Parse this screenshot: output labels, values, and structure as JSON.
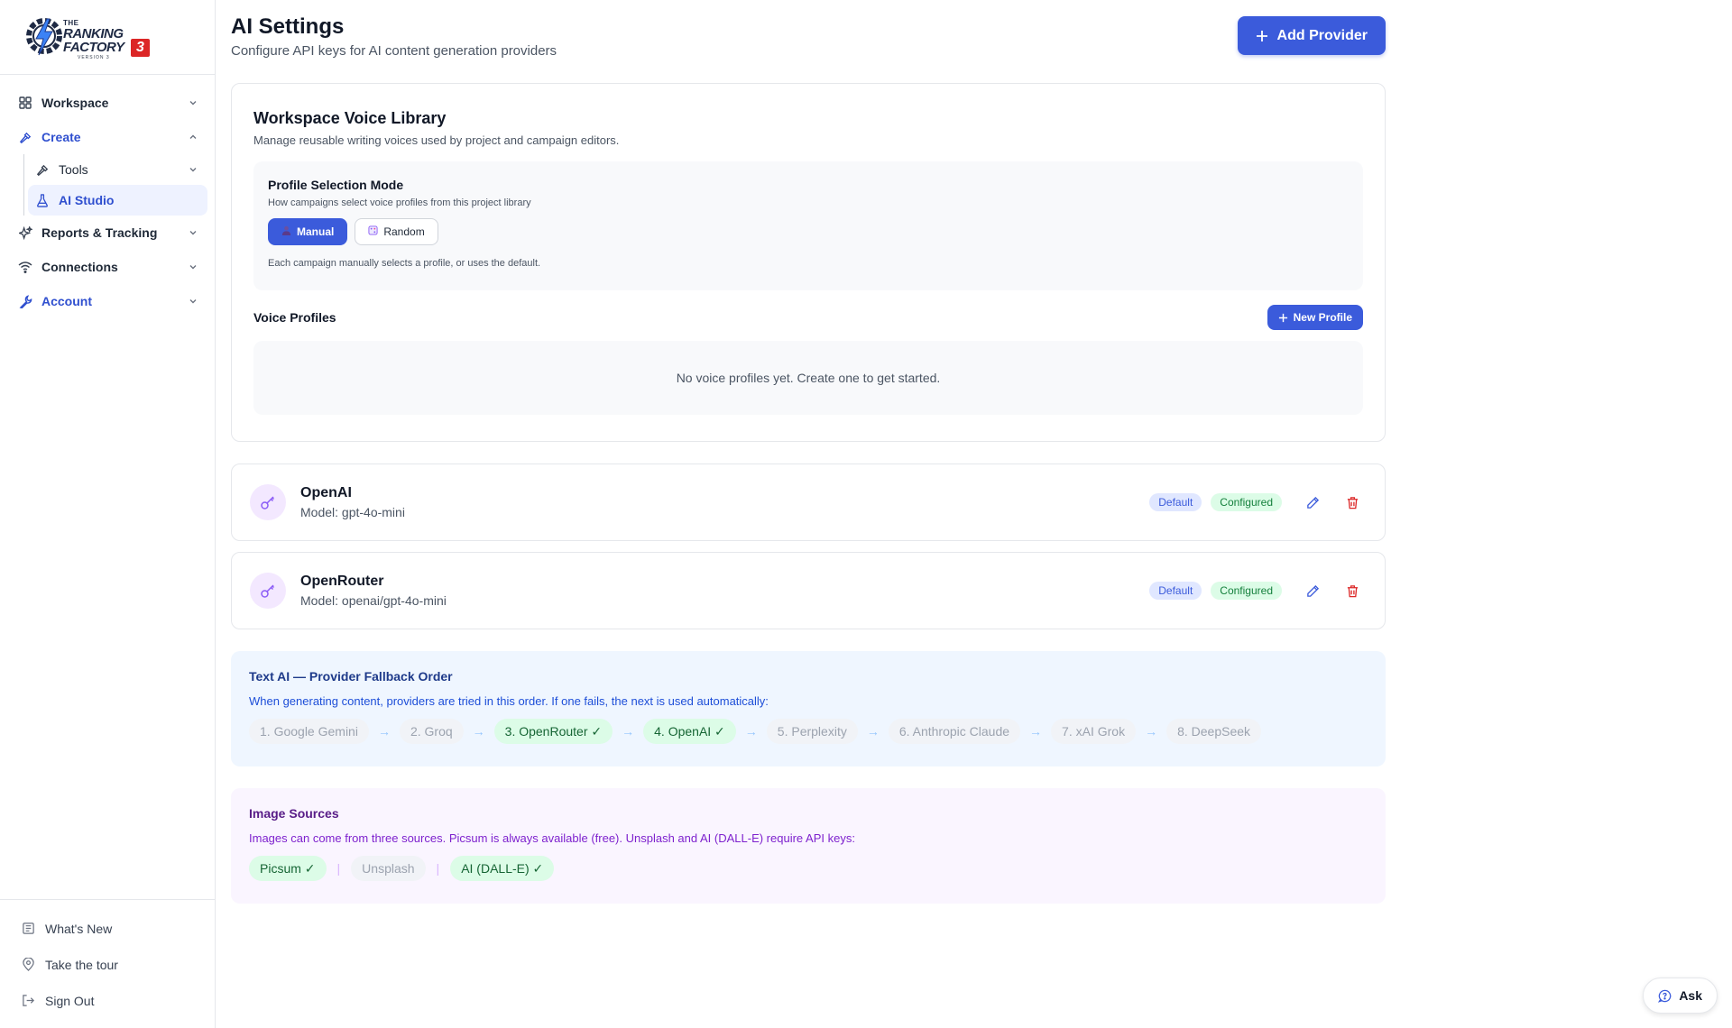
{
  "brand": {
    "logo_line1": "THE",
    "logo_line2": "RANKING",
    "logo_line3": "FACTORY",
    "logo_number": "3",
    "logo_version": "VERSION 3"
  },
  "sidebar": {
    "items": [
      {
        "label": "Workspace",
        "icon": "grid-icon"
      },
      {
        "label": "Create",
        "icon": "hammer-icon"
      },
      {
        "label": "Reports & Tracking",
        "icon": "sparkles-icon"
      },
      {
        "label": "Connections",
        "icon": "wifi-icon"
      },
      {
        "label": "Account",
        "icon": "wrench-icon"
      }
    ],
    "create_sub": [
      {
        "label": "Tools",
        "icon": "hammer-icon"
      },
      {
        "label": "AI Studio",
        "icon": "flask-icon"
      }
    ],
    "bottom": [
      {
        "label": "What's New",
        "icon": "newspaper-icon"
      },
      {
        "label": "Take the tour",
        "icon": "map-pin-icon"
      },
      {
        "label": "Sign Out",
        "icon": "sign-out-icon"
      }
    ]
  },
  "header": {
    "title": "AI Settings",
    "subtitle": "Configure API keys for AI content generation providers",
    "add_provider_label": "Add Provider"
  },
  "voice_library": {
    "title": "Workspace Voice Library",
    "subtitle": "Manage reusable writing voices used by project and campaign editors.",
    "mode": {
      "title": "Profile Selection Mode",
      "subtitle": "How campaigns select voice profiles from this project library",
      "manual_label": "Manual",
      "random_label": "Random",
      "selected": "Manual",
      "note": "Each campaign manually selects a profile, or uses the default."
    },
    "profiles_title": "Voice Profiles",
    "new_profile_label": "New Profile",
    "empty_text": "No voice profiles yet. Create one to get started."
  },
  "providers": [
    {
      "name": "OpenAI",
      "model": "Model: gpt-4o-mini",
      "badge_default": "Default",
      "badge_status": "Configured"
    },
    {
      "name": "OpenRouter",
      "model": "Model: openai/gpt-4o-mini",
      "badge_default": "Default",
      "badge_status": "Configured"
    }
  ],
  "fallback": {
    "title": "Text AI — Provider Fallback Order",
    "subtitle": "When generating content, providers are tried in this order. If one fails, the next is used automatically:",
    "order": [
      {
        "label": "1. Google Gemini",
        "configured": false
      },
      {
        "label": "2. Groq",
        "configured": false
      },
      {
        "label": "3. OpenRouter ✓",
        "configured": true
      },
      {
        "label": "4. OpenAI ✓",
        "configured": true
      },
      {
        "label": "5. Perplexity",
        "configured": false
      },
      {
        "label": "6. Anthropic Claude",
        "configured": false
      },
      {
        "label": "7. xAI Grok",
        "configured": false
      },
      {
        "label": "8. DeepSeek",
        "configured": false
      }
    ],
    "arrow": "→"
  },
  "image_sources": {
    "title": "Image Sources",
    "subtitle": "Images can come from three sources. Picsum is always available (free). Unsplash and AI (DALL-E) require API keys:",
    "sources": [
      {
        "label": "Picsum ✓",
        "configured": true
      },
      {
        "label": "Unsplash",
        "configured": false
      },
      {
        "label": "AI (DALL-E) ✓",
        "configured": true
      }
    ],
    "separator": "|"
  },
  "ask_label": "Ask",
  "colors": {
    "accent": "#3b5bdb",
    "configured_bg": "#dcfce7",
    "delete": "#dc2626",
    "brand_red": "#dc2626"
  }
}
